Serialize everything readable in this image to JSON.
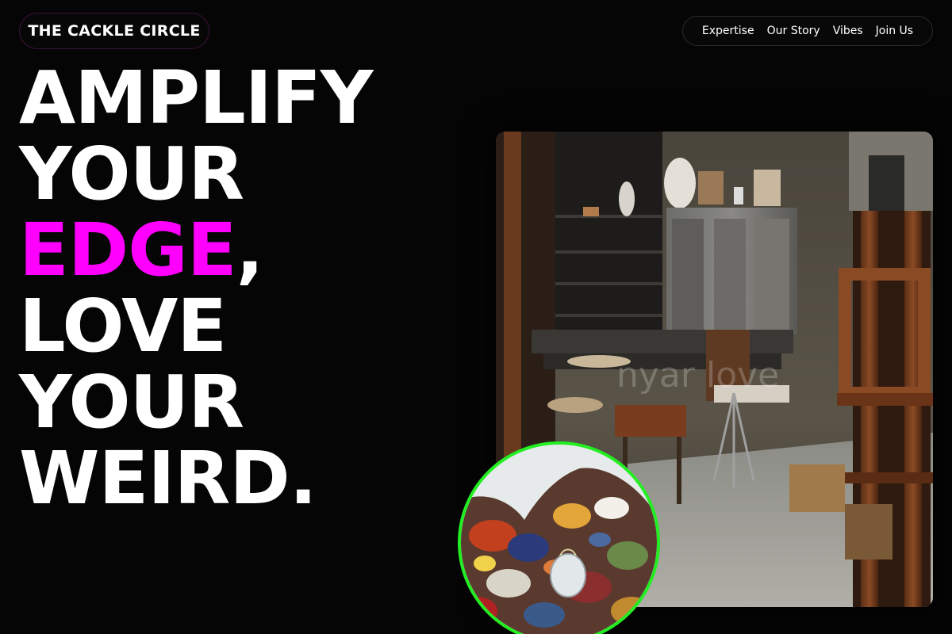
{
  "header": {
    "logo": "THE CACKLE CIRCLE",
    "nav": [
      {
        "label": "Expertise"
      },
      {
        "label": "Our Story"
      },
      {
        "label": "Vibes"
      },
      {
        "label": "Join Us"
      }
    ]
  },
  "hero": {
    "line1": "AMPLIFY",
    "line2": "YOUR",
    "line3_accent": "EDGE",
    "line3_rest": ",",
    "line4": "LOVE",
    "line5": "YOUR",
    "line6": "WEIRD."
  },
  "images": {
    "studio_watermark": "nyar love"
  },
  "colors": {
    "background": "#050505",
    "accent": "#ff00ff",
    "ring": "#22ee22"
  },
  "icons": [
    "studio-photo",
    "paint-palette-photo"
  ]
}
